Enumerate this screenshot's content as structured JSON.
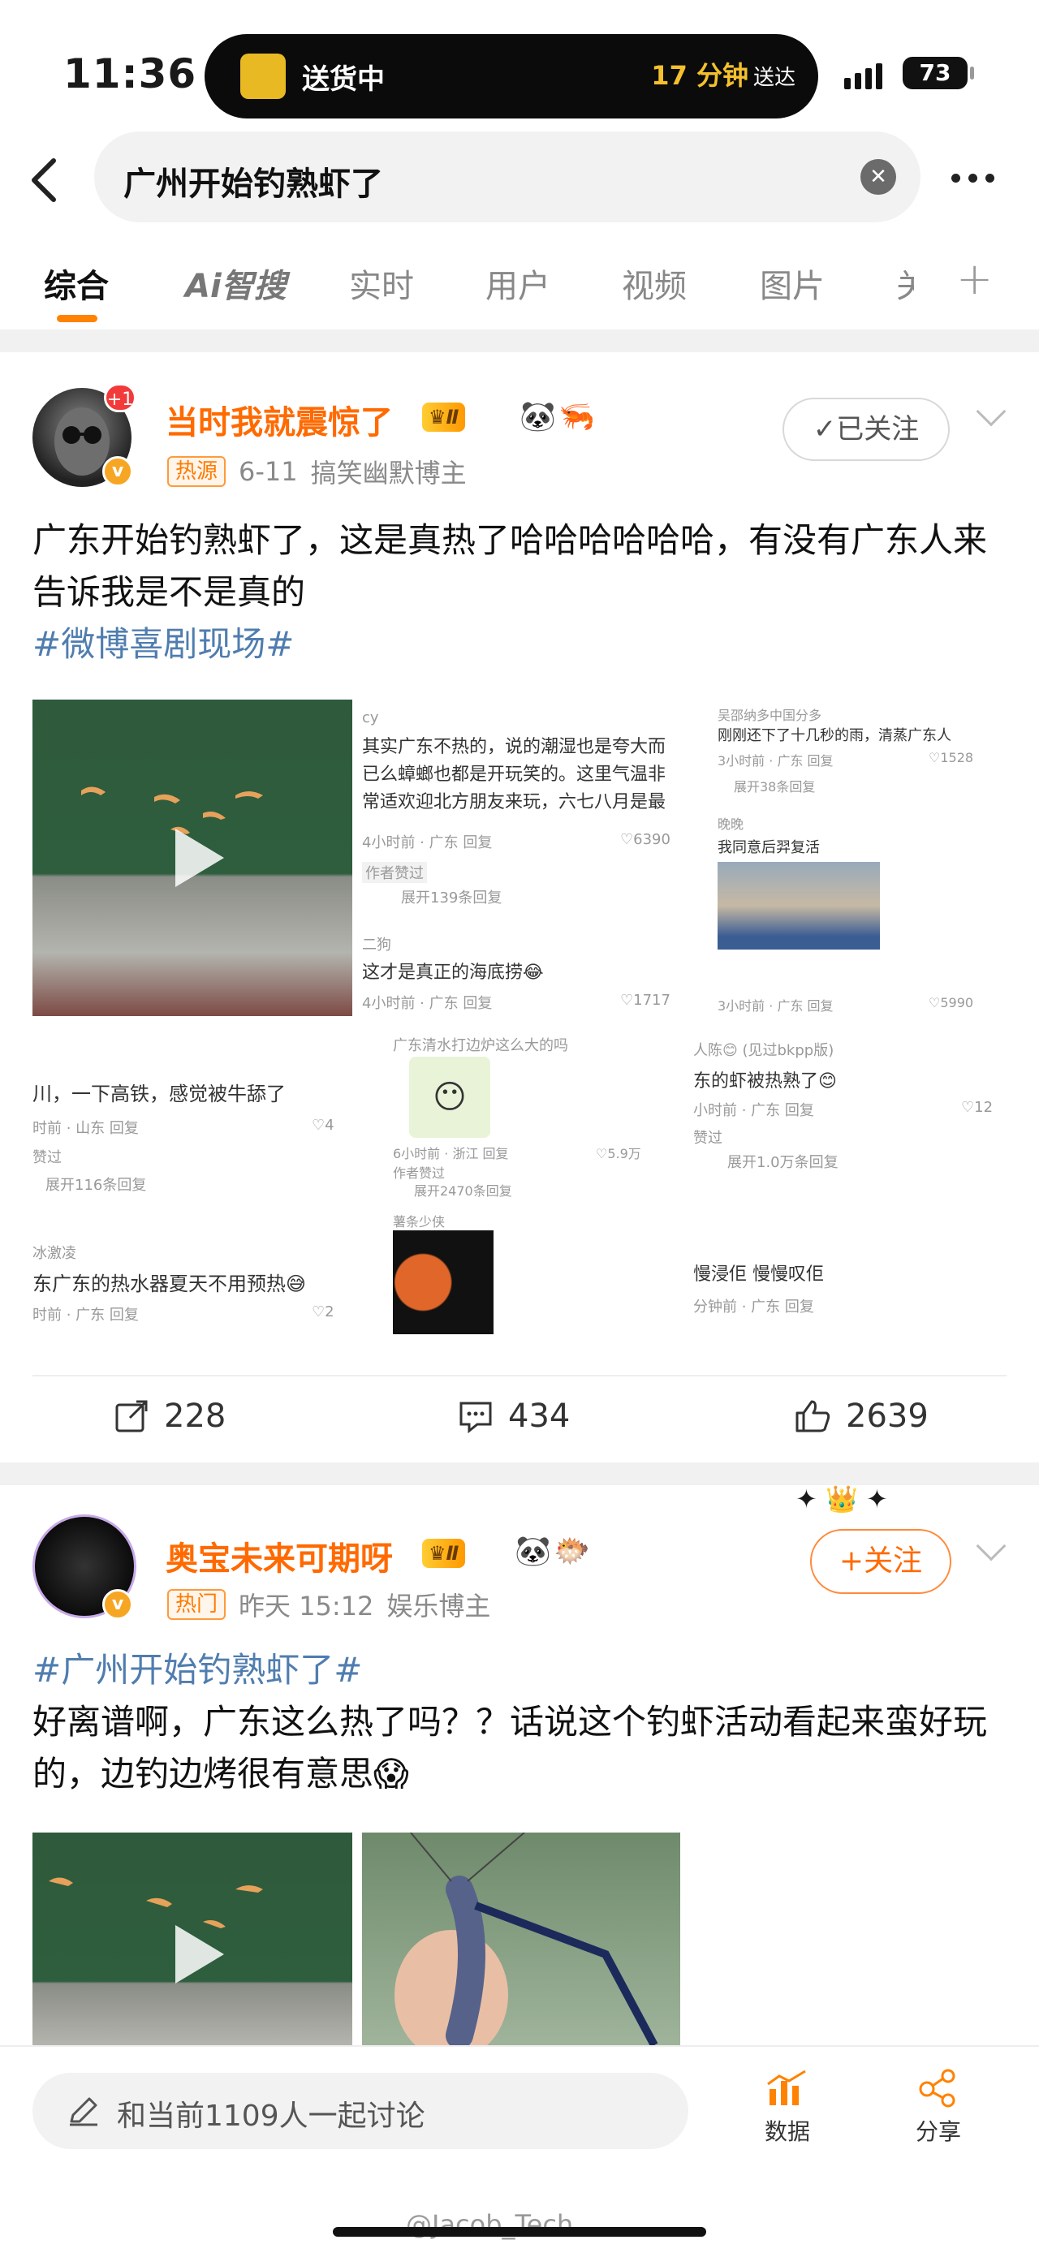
{
  "status_bar": {
    "time": "11:36",
    "delivery_status": "送货中",
    "eta": "17 分钟",
    "eta_suffix": "送达",
    "battery": "73"
  },
  "search": {
    "query": "广州开始钓熟虾了"
  },
  "tabs": [
    "综合",
    "Ai智搜",
    "实时",
    "用户",
    "视频",
    "图片",
    "关"
  ],
  "posts": [
    {
      "username": "当时我就震惊了",
      "level": "Ⅱ",
      "tag": "热源",
      "date": "6-11",
      "category": "搞笑幽默博主",
      "avatar_badge": "+1",
      "follow_label": "已关注",
      "text": "广东开始钓熟虾了，这是真热了哈哈哈哈哈哈，有没有广东人来告诉我是不是真的",
      "topic": "#微博喜剧现场#",
      "reposts": "228",
      "comments": "434",
      "likes": "2639",
      "collage": {
        "c1_user": "cy",
        "c1_text": "其实广东不热的，说的潮湿也是夸大而已么蟑螂也都是开玩笑的。这里气温非常适欢迎北方朋友来玩，六七八月是最好的时",
        "c1_meta": "4小时前 · 广东  回复",
        "c1_likes": "6390",
        "c1_badge": "作者赞过",
        "c1_expand": "展开139条回复",
        "c2_user": "二狗",
        "c2_text": "这才是真正的海底捞😂",
        "c2_meta": "4小时前 · 广东  回复",
        "c2_likes": "1717",
        "c3_user": "吴邵纳多中国分多",
        "c3_text": "刚刚还下了十几秒的雨，清蒸广东人",
        "c3_meta": "3小时前 · 广东  回复",
        "c3_likes": "1528",
        "c3_expand": "展开38条回复",
        "c4_user": "晚晚",
        "c4_text": "我同意后羿复活",
        "c4_meta": "3小时前 · 广东  回复",
        "c4_likes": "5990",
        "c5_text": "川，一下高铁，感觉被牛舔了",
        "c5_meta": "时前 · 山东  回复",
        "c5_likes": "4",
        "c5_badge": "赞过",
        "c5_expand": "展开116条回复",
        "c6_user": "冰激凌",
        "c6_text": "东广东的热水器夏天不用预热😅",
        "c6_meta": "时前 · 广东  回复",
        "c6_likes": "2",
        "c7_text": "广东清水打边炉这么大的吗",
        "c7_meta": "6小时前 · 浙江  回复",
        "c7_likes": "5.9万",
        "c7_badge": "作者赞过",
        "c7_expand": "展开2470条回复",
        "c8_user": "薯条少侠",
        "c9_user": "人陈😊 (见过bkpp版)",
        "c9_text": "东的虾被热熟了😊",
        "c9_meta": "小时前 · 广东  回复",
        "c9_likes": "12",
        "c9_badge": "赞过",
        "c9_expand": "展开1.0万条回复",
        "c10_text": "慢浸佢 慢慢叹佢",
        "c10_meta": "分钟前 · 广东  回复"
      }
    },
    {
      "username": "奥宝未来可期呀",
      "level": "Ⅱ",
      "tag": "热门",
      "date": "昨天 15:12",
      "category": "娱乐博主",
      "follow_label": "+关注",
      "topic": "#广州开始钓熟虾了#",
      "text": "好离谱啊，广东这么热了吗？？话说这个钓虾活动看起来蛮好玩的，边钓边烤很有意思😱"
    }
  ],
  "bottom_bar": {
    "placeholder": "和当前1109人一起讨论",
    "data_label": "数据",
    "share_label": "分享"
  },
  "watermark": "@Jacob_Tech",
  "colors": {
    "accent": "#ff8200",
    "username": "#ff6a00",
    "topic": "#507daf"
  }
}
